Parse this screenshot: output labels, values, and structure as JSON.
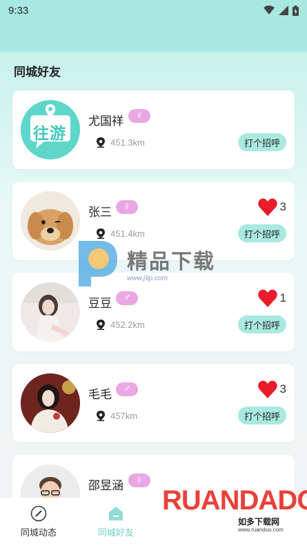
{
  "status_bar": {
    "time": "9:33"
  },
  "section": {
    "title": "同城好友"
  },
  "friends": [
    {
      "name": "尤国祥",
      "gender": "female",
      "gender_symbol": "♀",
      "distance": "451.3km",
      "likes": null,
      "greet_label": "打个招呼",
      "avatar": "logo"
    },
    {
      "name": "张三",
      "gender": "female",
      "gender_symbol": "♀",
      "distance": "451.4km",
      "likes": "3",
      "greet_label": "打个招呼",
      "avatar": "dog"
    },
    {
      "name": "豆豆",
      "gender": "male",
      "gender_symbol": "♂",
      "distance": "452.2km",
      "likes": "1",
      "greet_label": "打个招呼",
      "avatar": "girl1"
    },
    {
      "name": "毛毛",
      "gender": "male",
      "gender_symbol": "♂",
      "distance": "457km",
      "likes": "3",
      "greet_label": "打个招呼",
      "avatar": "girl2"
    },
    {
      "name": "邵昱涵",
      "gender": "female",
      "gender_symbol": "♀",
      "distance": "",
      "likes": null,
      "greet_label": "",
      "avatar": "man"
    }
  ],
  "logo_text": "往游",
  "bottom_nav": {
    "items": [
      {
        "label": "同城动态",
        "icon": "compass-icon",
        "active": false
      },
      {
        "label": "同城好友",
        "icon": "home-icon",
        "active": true
      }
    ]
  },
  "watermark": {
    "text": "精品下载",
    "url": "www.j9p.com",
    "corner_text": "RUANDADO",
    "corner_sub": "如多下载网",
    "corner_url": "www.ruanduo.com"
  },
  "colors": {
    "accent": "#a9e9e1",
    "female_pill": "#e9a7e4",
    "like_red": "#e81c2b",
    "nav_active": "#6fd0c7"
  }
}
